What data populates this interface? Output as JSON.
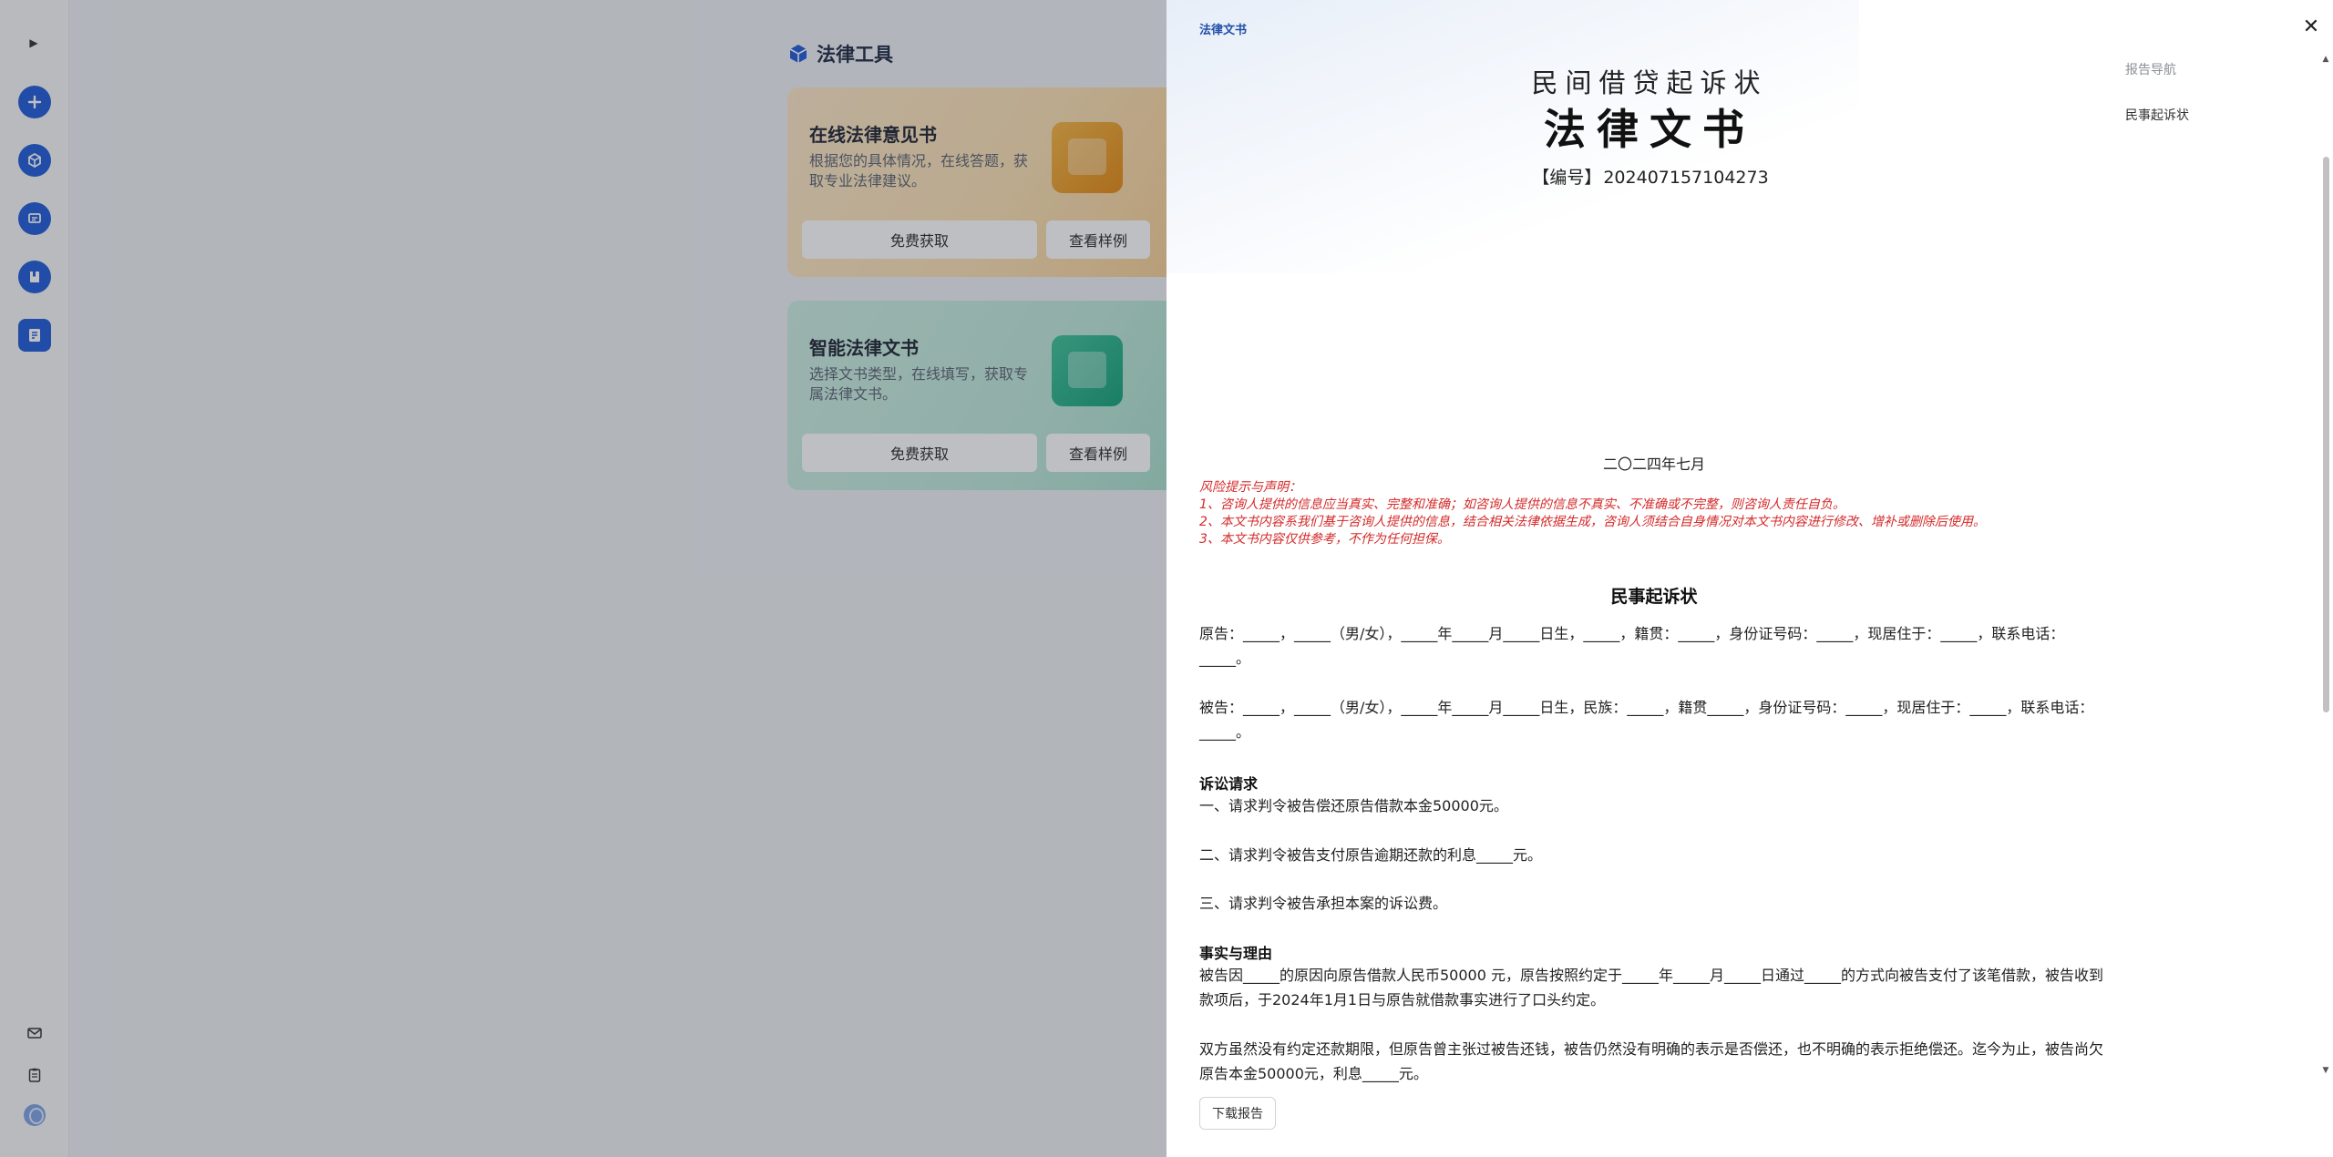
{
  "sidebar": {
    "expand_icon": "play-triangle-icon",
    "nav_icons": [
      "plus-icon",
      "cube-icon",
      "chat-icon",
      "book-icon",
      "document-icon"
    ],
    "bottom_icons": [
      "mail-icon",
      "clipboard-icon"
    ],
    "accent_color": "#1f5bd8"
  },
  "main": {
    "tools_title": "法律工具",
    "cards": [
      {
        "title": "在线法律意见书",
        "desc": "根据您的具体情况，在线答题，获取专业法律建议。",
        "primary_btn": "免费获取",
        "secondary_btn": "查看样例"
      },
      {
        "title": "智能法律文书",
        "desc": "选择文书类型，在线填写，获取专属法律文书。",
        "primary_btn": "免费获取",
        "secondary_btn": "查看样例"
      }
    ]
  },
  "drawer": {
    "title": "法律文书",
    "close_icon": "close-icon",
    "doc_subtitle": "民间借贷起诉状",
    "doc_title": "法律文书",
    "number_label": "【编号】",
    "number_value": "202407157104273",
    "date": "二〇二四年七月",
    "risk_title": "风险提示与声明：",
    "risk_items": [
      "1、咨询人提供的信息应当真实、完整和准确；如咨询人提供的信息不真实、不准确或不完整，则咨询人责任自负。",
      "2、本文书内容系我们基于咨询人提供的信息，结合相关法律依据生成，咨询人须结合自身情况对本文书内容进行修改、增补或删除后使用。",
      "3、本文书内容仅供参考，不作为任何担保。"
    ],
    "section_title": "民事起诉状",
    "plaintiff": "原告：_____，_____（男/女），_____年_____月_____日生，_____，籍贯：_____，身份证号码：_____，现居住于：_____，联系电话：_____。",
    "defendant": "被告：_____，_____（男/女），_____年_____月_____日生，民族：_____，籍贯_____，身份证号码：_____，现居住于：_____，联系电话：_____。",
    "claims_heading": "诉讼请求",
    "claims": [
      "一、请求判令被告偿还原告借款本金50000元。",
      "二、请求判令被告支付原告逾期还款的利息_____元。",
      "三、请求判令被告承担本案的诉讼费。"
    ],
    "facts_heading": "事实与理由",
    "facts": [
      "被告因_____的原因向原告借款人民币50000 元，原告按照约定于_____年_____月_____日通过_____的方式向被告支付了该笔借款，被告收到款项后，于2024年1月1日与原告就借款事实进行了口头约定。",
      "双方虽然没有约定还款期限，但原告曾主张过被告还钱，被告仍然没有明确的表示是否偿还，也不明确的表示拒绝偿还。迄今为止，被告尚欠原告本金50000元，利息_____元。"
    ],
    "download_btn": "下载报告",
    "report_nav_title": "报告导航",
    "report_nav_item": "民事起诉状"
  }
}
